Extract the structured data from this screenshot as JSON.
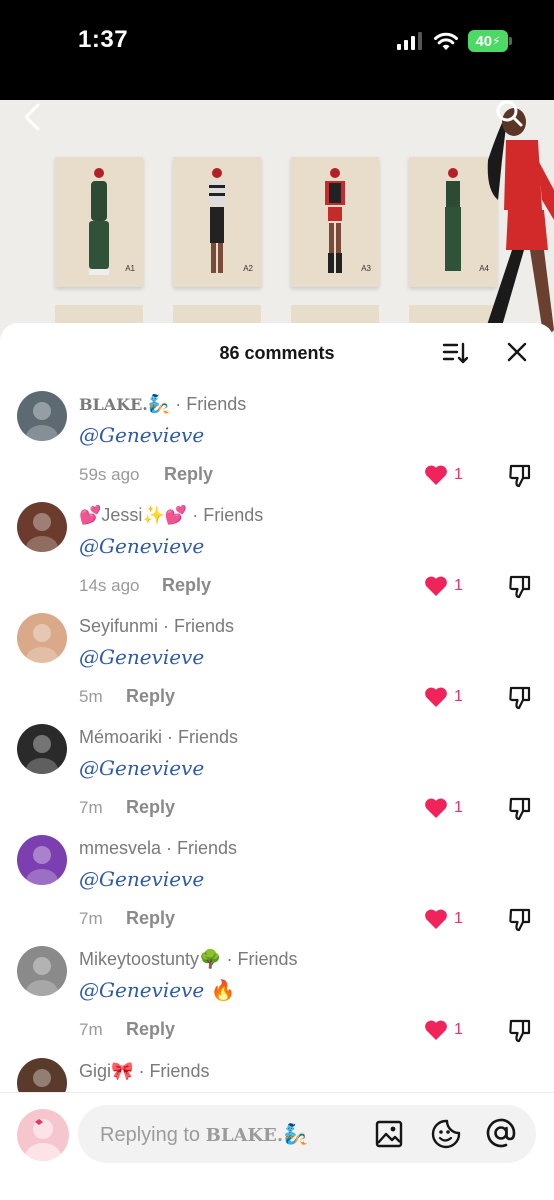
{
  "status_bar": {
    "time": "1:37",
    "battery": "40"
  },
  "video": {
    "tags": [
      "A1",
      "A2",
      "A3",
      "A4"
    ]
  },
  "comments_header": {
    "title": "86 comments"
  },
  "comments": [
    {
      "user": "BLAKE.",
      "user_emoji": "🧞",
      "user_style": "serif",
      "relation": "Friends",
      "text": "@Genevieve",
      "text_emoji": "",
      "time": "59s ago",
      "reply": "Reply",
      "likes": "1",
      "avatar_color": "#5d6a72"
    },
    {
      "user": "Jessi",
      "user_prefix": "💕",
      "user_emoji": "✨💕",
      "user_style": "sans",
      "relation": "Friends",
      "text": "@Genevieve",
      "text_emoji": "",
      "time": "14s ago",
      "reply": "Reply",
      "likes": "1",
      "avatar_color": "#6b3b2d"
    },
    {
      "user": "Seyifunmi",
      "user_emoji": "",
      "user_style": "sans",
      "relation": "Friends",
      "text": "@Genevieve",
      "text_emoji": "",
      "time": "5m",
      "reply": "Reply",
      "likes": "1",
      "avatar_color": "#d9a98a"
    },
    {
      "user": "Mémoariki",
      "user_emoji": "",
      "user_style": "sans",
      "relation": "Friends",
      "text": "@Genevieve",
      "text_emoji": "",
      "time": "7m",
      "reply": "Reply",
      "likes": "1",
      "avatar_color": "#2a2a2a"
    },
    {
      "user": "mmesvela",
      "user_emoji": "",
      "user_style": "sans",
      "relation": "Friends",
      "text": "@Genevieve",
      "text_emoji": "",
      "time": "7m",
      "reply": "Reply",
      "likes": "1",
      "avatar_color": "#7b3fb0"
    },
    {
      "user": "Mikeytoostunty",
      "user_emoji": "🌳",
      "user_style": "sans",
      "relation": "Friends",
      "text": "@Genevieve",
      "text_emoji": "🔥",
      "time": "7m",
      "reply": "Reply",
      "likes": "1",
      "avatar_color": "#8a8a8a"
    },
    {
      "user": "Gigi",
      "user_emoji": "🎀",
      "user_style": "sans",
      "relation": "Friends",
      "text": "",
      "text_emoji": "",
      "time": "",
      "reply": "",
      "likes": "",
      "avatar_color": "#5a3a2a"
    }
  ],
  "reply_bar": {
    "placeholder_prefix": "Replying to ",
    "placeholder_user": "BLAKE.",
    "placeholder_emoji": "🧞"
  },
  "colors": {
    "accent_like": "#f0245b",
    "mention_blue": "#2f5aa8"
  }
}
